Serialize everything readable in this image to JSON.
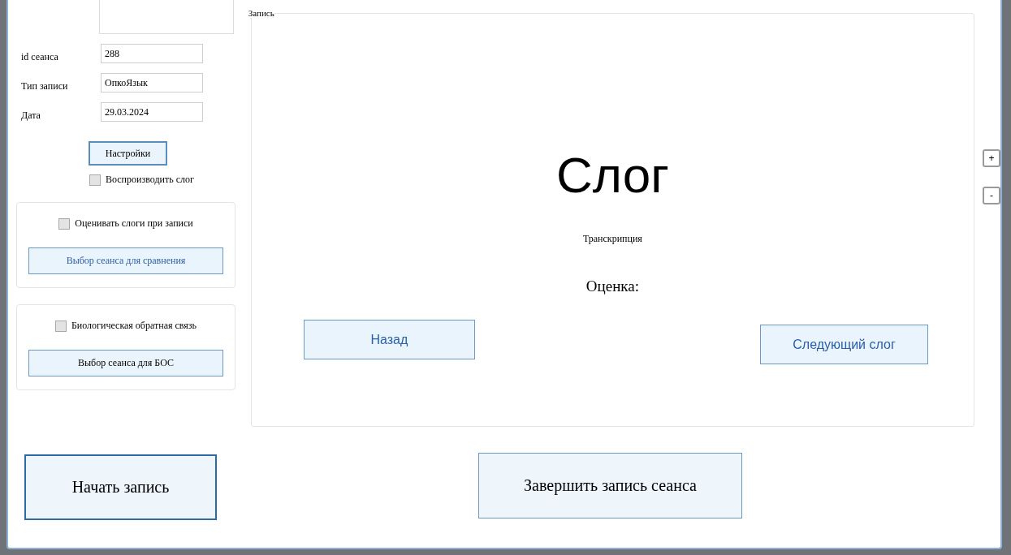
{
  "fields": [
    {
      "label": "id сеанса",
      "value": "288"
    },
    {
      "label": "Тип записи",
      "value": "ОпкоЯзык"
    },
    {
      "label": "Дата",
      "value": "29.03.2024"
    }
  ],
  "settings_button": "Настройки",
  "play_syllable": {
    "label": "Воспроизводить слог",
    "checked": false
  },
  "panels": [
    {
      "checkbox": {
        "label": "Оценивать слоги при записи",
        "checked": false
      },
      "button": "Выбор сеанса для сравнения"
    },
    {
      "checkbox": {
        "label": "Биологическая обратная связь",
        "checked": false
      },
      "button": "Выбор сеанса для БОС"
    }
  ],
  "start_button": "Начать запись",
  "record_group": {
    "title": "Запись",
    "syllable": "Слог",
    "transcription": "Транскрипция",
    "score": "Оценка:",
    "back_button": "Назад",
    "next_button": "Следующий слог"
  },
  "zoom_buttons": [
    "+",
    "-"
  ],
  "finish_button": "Завершить запись сеанса"
}
